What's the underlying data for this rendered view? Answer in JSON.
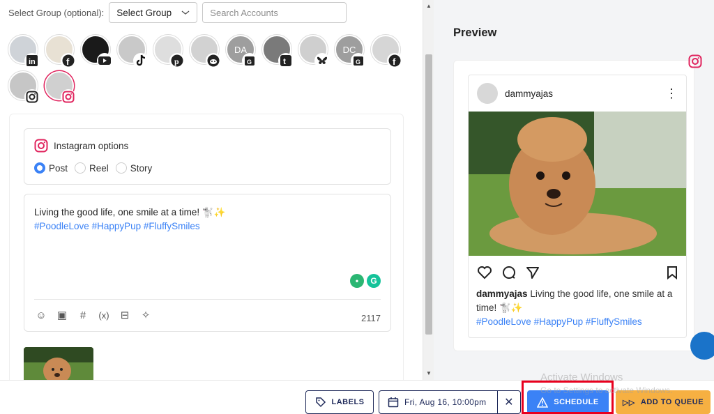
{
  "group": {
    "label": "Select Group (optional):",
    "select_value": "Select Group",
    "search_placeholder": "Search Accounts"
  },
  "accounts": [
    {
      "platform": "linkedin",
      "initials": ""
    },
    {
      "platform": "facebook",
      "initials": ""
    },
    {
      "platform": "youtube",
      "initials": ""
    },
    {
      "platform": "tiktok",
      "initials": ""
    },
    {
      "platform": "pinterest",
      "initials": ""
    },
    {
      "platform": "reddit",
      "initials": ""
    },
    {
      "platform": "google-business",
      "initials": "DA"
    },
    {
      "platform": "tumblr",
      "initials": ""
    },
    {
      "platform": "bluesky",
      "initials": ""
    },
    {
      "platform": "google-business",
      "initials": "DC"
    },
    {
      "platform": "facebook",
      "initials": ""
    },
    {
      "platform": "instagram",
      "initials": ""
    },
    {
      "platform": "instagram",
      "initials": ""
    }
  ],
  "instagram_options": {
    "title": "Instagram options",
    "types": [
      "Post",
      "Reel",
      "Story"
    ],
    "selected": "Post"
  },
  "composer": {
    "text": "Living the good life, one smile at a time! 🐩✨",
    "hashtags": "#PoodleLove #HappyPup #FluffySmiles",
    "char_count": "2117"
  },
  "preview": {
    "title": "Preview",
    "username": "dammyajas",
    "caption": "Living the good life, one smile at a time! 🐩✨",
    "hashtags": "#PoodleLove #HappyPup #FluffySmiles"
  },
  "bottom": {
    "labels_button": "LABELS",
    "date": "Fri, Aug 16, 10:00pm",
    "schedule_button": "SCHEDULE",
    "queue_button": "ADD TO QUEUE"
  },
  "watermark": {
    "line1": "Activate Windows",
    "line2": "Go to Settings to activate Windows."
  },
  "colors": {
    "primary": "#3b82f6",
    "queue": "#f6b042",
    "highlight": "#e8001e",
    "instagram": "#e0245e"
  }
}
